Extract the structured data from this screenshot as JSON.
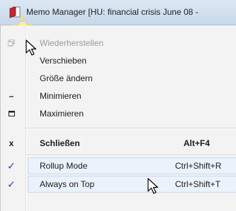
{
  "window": {
    "title": "Memo Manager [HU: financial crisis June 08 -"
  },
  "menu": {
    "items": [
      {
        "label": "Wiederherstellen",
        "shortcut": "",
        "icon": "restore-icon",
        "state": "disabled"
      },
      {
        "label": "Verschieben",
        "shortcut": "",
        "icon": "",
        "state": "normal"
      },
      {
        "label": "Größe ändern",
        "shortcut": "",
        "icon": "",
        "state": "normal"
      },
      {
        "label": "Minimieren",
        "shortcut": "",
        "icon": "minimize-icon",
        "icon_glyph": "–",
        "state": "normal"
      },
      {
        "label": "Maximieren",
        "shortcut": "",
        "icon": "maximize-icon",
        "icon_glyph": "□",
        "state": "normal"
      },
      {
        "label": "Schließen",
        "shortcut": "Alt+F4",
        "icon": "close-icon",
        "icon_glyph": "x",
        "state": "bold"
      },
      {
        "label": "Rollup Mode",
        "shortcut": "Ctrl+Shift+R",
        "icon": "check-icon",
        "icon_glyph": "✓",
        "state": "checked"
      },
      {
        "label": "Always on Top",
        "shortcut": "Ctrl+Shift+T",
        "icon": "check-icon",
        "icon_glyph": "✓",
        "state": "checked"
      }
    ]
  },
  "colors": {
    "titlebar": "#c8d8ea",
    "menu_bg": "#f3f3f3",
    "check": "#1b4b9e",
    "app_icon_red": "#b22222"
  }
}
